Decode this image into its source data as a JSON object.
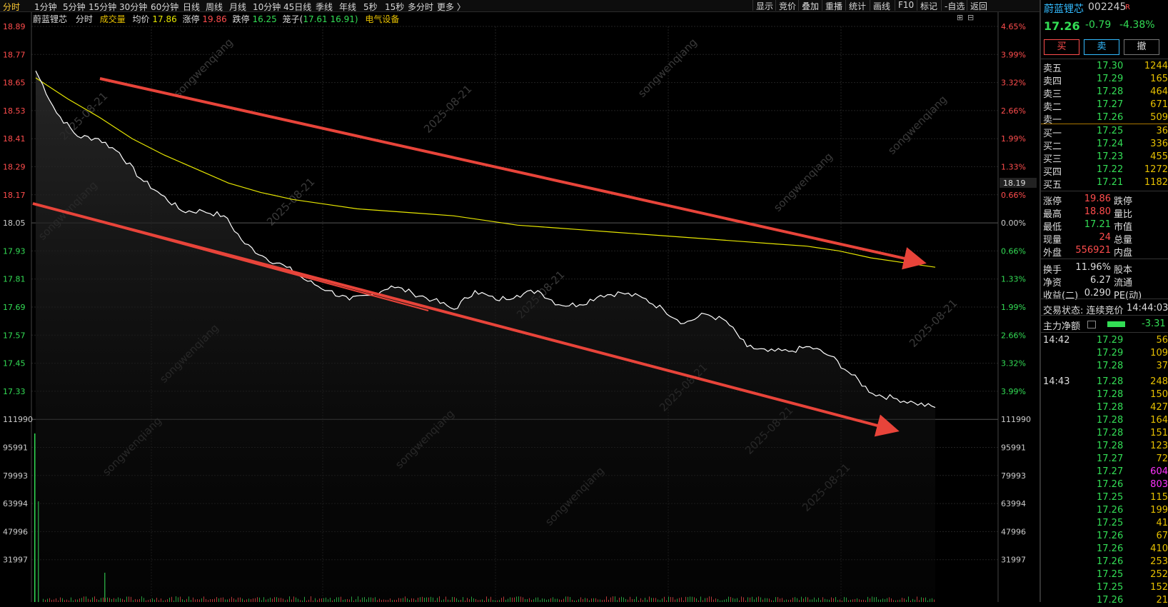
{
  "periods": [
    "分时",
    "1分钟",
    "5分钟",
    "15分钟",
    "30分钟",
    "60分钟",
    "日线",
    "周线",
    "月线",
    "10分钟",
    "45日线",
    "季线",
    "年线",
    "5秒",
    "15秒",
    "多分时",
    "更多 〉"
  ],
  "tools": [
    "显示",
    "竞价",
    "叠加",
    "重播",
    "统计",
    "画线",
    "F10",
    "标记",
    "-自选",
    "返回"
  ],
  "info": {
    "name": "蔚蓝锂芯",
    "tab": "分时",
    "volume": "成交量",
    "avg_label": "均价",
    "avg": "17.86",
    "up_label": "涨停",
    "up": "19.86",
    "down_label": "跌停",
    "down": "16.25",
    "cage_label": "笼子(",
    "cage": "17.61 16.91)",
    "sector": "电气设备"
  },
  "watermark": {
    "name": "songwenqiang",
    "date": "2025-08-21"
  },
  "price_axis": [
    "18.89",
    "18.77",
    "18.65",
    "18.53",
    "18.41",
    "18.29",
    "18.17",
    "18.05",
    "17.93",
    "17.81",
    "17.69",
    "17.57",
    "17.45",
    "17.33",
    "111990",
    "95991",
    "79993",
    "63994",
    "47996",
    "31997"
  ],
  "pct_axis": [
    "4.65%",
    "3.99%",
    "3.32%",
    "2.66%",
    "1.99%",
    "1.33%",
    "0.66%",
    "0.00%",
    "0.66%",
    "1.33%",
    "1.99%",
    "2.66%",
    "3.32%",
    "3.99%",
    "111990",
    "95991",
    "79993",
    "63994",
    "47996",
    "31997"
  ],
  "cursor_price": "18.19",
  "chart_data": {
    "type": "line",
    "prev_close": 18.05,
    "ylim": [
      17.21,
      18.89
    ],
    "series": [],
    "price": [
      18.7,
      18.52,
      18.42,
      18.41,
      18.35,
      18.24,
      18.17,
      18.1,
      18.1,
      18.08,
      17.96,
      17.9,
      17.86,
      17.8,
      17.76,
      17.72,
      17.74,
      17.78,
      17.75,
      17.72,
      17.68,
      17.76,
      17.72,
      17.74,
      17.76,
      17.7,
      17.7,
      17.74,
      17.75,
      17.73,
      17.68,
      17.62,
      17.66,
      17.63,
      17.52,
      17.5,
      17.5,
      17.52,
      17.48,
      17.4,
      17.32,
      17.3,
      17.28,
      17.26
    ],
    "avg": [
      18.67,
      18.58,
      18.5,
      18.41,
      18.34,
      18.28,
      18.22,
      18.18,
      18.15,
      18.13,
      18.11,
      18.1,
      18.09,
      18.08,
      18.06,
      18.04,
      18.03,
      18.02,
      18.01,
      18.0,
      17.99,
      17.98,
      17.97,
      17.96,
      17.95,
      17.93,
      17.9,
      17.88,
      17.86
    ]
  },
  "stock": {
    "name": "蔚蓝锂芯",
    "code": "002245",
    "badge": "R",
    "price": "17.26",
    "change": "-0.79",
    "pct": "-4.38%"
  },
  "buttons": {
    "buy": "买",
    "sell": "卖",
    "cancel": "撤"
  },
  "asks": [
    {
      "label": "卖五",
      "price": "17.30",
      "vol": "1244"
    },
    {
      "label": "卖四",
      "price": "17.29",
      "vol": "165"
    },
    {
      "label": "卖三",
      "price": "17.28",
      "vol": "464"
    },
    {
      "label": "卖二",
      "price": "17.27",
      "vol": "671"
    },
    {
      "label": "卖一",
      "price": "17.26",
      "vol": "509"
    }
  ],
  "bids": [
    {
      "label": "买一",
      "price": "17.25",
      "vol": "36"
    },
    {
      "label": "买二",
      "price": "17.24",
      "vol": "336"
    },
    {
      "label": "买三",
      "price": "17.23",
      "vol": "455"
    },
    {
      "label": "买四",
      "price": "17.22",
      "vol": "1272"
    },
    {
      "label": "买五",
      "price": "17.21",
      "vol": "1182"
    }
  ],
  "stats": [
    {
      "label": "涨停",
      "value": "19.86",
      "label2": "跌停"
    },
    {
      "label": "最高",
      "value": "18.80",
      "label2": "量比"
    },
    {
      "label": "最低",
      "value": "17.21",
      "label2": "市值"
    },
    {
      "label": "现量",
      "value": "24",
      "label2": "总量"
    },
    {
      "label": "外盘",
      "value": "556921",
      "label2": "内盘"
    }
  ],
  "stats2": [
    {
      "label": "换手",
      "value": "11.96%",
      "label2": "股本"
    },
    {
      "label": "净资",
      "value": "6.27",
      "label2": "流通"
    },
    {
      "label": "收益(二)",
      "value": "0.290",
      "label2": "PE(动)"
    }
  ],
  "status": {
    "label": "交易状态: 连续竞价",
    "time": "14:44:03"
  },
  "fund": {
    "label": "主力净额",
    "value": "-3.31"
  },
  "ticks": [
    {
      "t": "14:42",
      "p": "17.29",
      "v": "56"
    },
    {
      "t": "",
      "p": "17.29",
      "v": "109"
    },
    {
      "t": "",
      "p": "17.28",
      "v": "37"
    },
    {
      "t": "14:43",
      "p": "17.28",
      "v": "248"
    },
    {
      "t": "",
      "p": "17.28",
      "v": "150"
    },
    {
      "t": "",
      "p": "17.28",
      "v": "427"
    },
    {
      "t": "",
      "p": "17.28",
      "v": "164"
    },
    {
      "t": "",
      "p": "17.28",
      "v": "151"
    },
    {
      "t": "",
      "p": "17.28",
      "v": "123"
    },
    {
      "t": "",
      "p": "17.27",
      "v": "72"
    },
    {
      "t": "",
      "p": "17.27",
      "v": "604"
    },
    {
      "t": "",
      "p": "17.26",
      "v": "803"
    },
    {
      "t": "",
      "p": "17.25",
      "v": "115"
    },
    {
      "t": "",
      "p": "17.26",
      "v": "199"
    },
    {
      "t": "",
      "p": "17.25",
      "v": "41"
    },
    {
      "t": "",
      "p": "17.26",
      "v": "67"
    },
    {
      "t": "",
      "p": "17.26",
      "v": "410"
    },
    {
      "t": "",
      "p": "17.26",
      "v": "253"
    },
    {
      "t": "",
      "p": "17.25",
      "v": "252"
    },
    {
      "t": "",
      "p": "17.25",
      "v": "152"
    },
    {
      "t": "",
      "p": "17.26",
      "v": "21"
    }
  ],
  "colors": {
    "up": "#ff4d4d",
    "down": "#33dd55",
    "avg": "#e6e600",
    "price": "#ffffff",
    "arrow": "#e8443a",
    "magenta": "#ff33ff"
  }
}
